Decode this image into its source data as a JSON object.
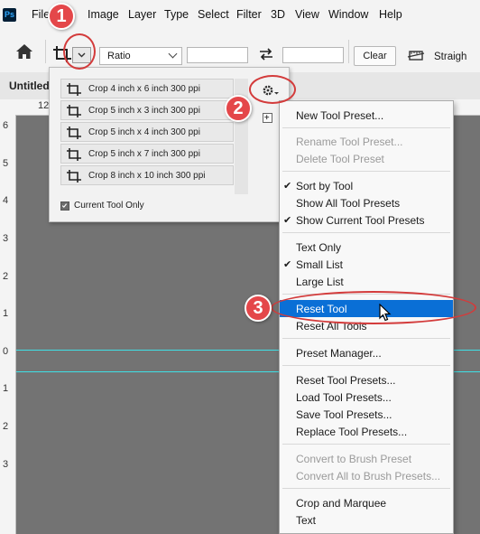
{
  "app": {
    "logo": "Ps"
  },
  "menubar": [
    {
      "label": "File"
    },
    {
      "label": "Image"
    },
    {
      "label": "Layer"
    },
    {
      "label": "Type"
    },
    {
      "label": "Select"
    },
    {
      "label": "Filter"
    },
    {
      "label": "3D"
    },
    {
      "label": "View"
    },
    {
      "label": "Window"
    },
    {
      "label": "Help"
    }
  ],
  "options": {
    "ratio_value": "Ratio",
    "clear_label": "Clear",
    "straighten_label": "Straigh",
    "icons": [
      "home-icon",
      "crop-tool-icon",
      "chevron-down-icon",
      "swap-icon",
      "straighten-icon"
    ]
  },
  "document": {
    "tab_label": "Untitled",
    "ruler_top_text": "12"
  },
  "ruler_left_numbers": [
    "6",
    "5",
    "4",
    "3",
    "2",
    "1",
    "0",
    "1",
    "2",
    "3"
  ],
  "preset_panel": {
    "presets": [
      {
        "label": "Crop 4 inch x 6 inch 300 ppi"
      },
      {
        "label": "Crop 5 inch x 3 inch 300 ppi"
      },
      {
        "label": "Crop 5 inch x 4 inch 300 ppi"
      },
      {
        "label": "Crop 5 inch x 7 inch 300 ppi"
      },
      {
        "label": "Crop 8 inch x 10 inch 300 ppi"
      }
    ],
    "current_tool_only_label": "Current Tool Only",
    "current_tool_only_checked": true
  },
  "context_menu": {
    "items": [
      {
        "label": "New Tool Preset...",
        "disabled": false,
        "checked": false
      },
      {
        "label": "Rename Tool Preset...",
        "disabled": true,
        "checked": false
      },
      {
        "label": "Delete Tool Preset",
        "disabled": true,
        "checked": false
      },
      {
        "label": "Sort by Tool",
        "disabled": false,
        "checked": true
      },
      {
        "label": "Show All Tool Presets",
        "disabled": false,
        "checked": false
      },
      {
        "label": "Show Current Tool Presets",
        "disabled": false,
        "checked": true
      },
      {
        "label": "Text Only",
        "disabled": false,
        "checked": false
      },
      {
        "label": "Small List",
        "disabled": false,
        "checked": true
      },
      {
        "label": "Large List",
        "disabled": false,
        "checked": false
      },
      {
        "label": "Reset Tool",
        "disabled": false,
        "checked": false,
        "highlighted": true
      },
      {
        "label": "Reset All Tools",
        "disabled": false,
        "checked": false
      },
      {
        "label": "Preset Manager...",
        "disabled": false,
        "checked": false
      },
      {
        "label": "Reset Tool Presets...",
        "disabled": false,
        "checked": false
      },
      {
        "label": "Load Tool Presets...",
        "disabled": false,
        "checked": false
      },
      {
        "label": "Save Tool Presets...",
        "disabled": false,
        "checked": false
      },
      {
        "label": "Replace Tool Presets...",
        "disabled": false,
        "checked": false
      },
      {
        "label": "Convert to Brush Preset",
        "disabled": true,
        "checked": false
      },
      {
        "label": "Convert All to Brush Presets...",
        "disabled": true,
        "checked": false
      },
      {
        "label": "Crop and Marquee",
        "disabled": false,
        "checked": false
      },
      {
        "label": "Text",
        "disabled": false,
        "checked": false
      }
    ]
  },
  "annotations": {
    "steps": [
      "1",
      "2",
      "3"
    ],
    "color": "#e4474a"
  },
  "colors": {
    "highlight": "#0a6fd6",
    "guide": "#3fe0e6",
    "canvas": "#737373"
  }
}
